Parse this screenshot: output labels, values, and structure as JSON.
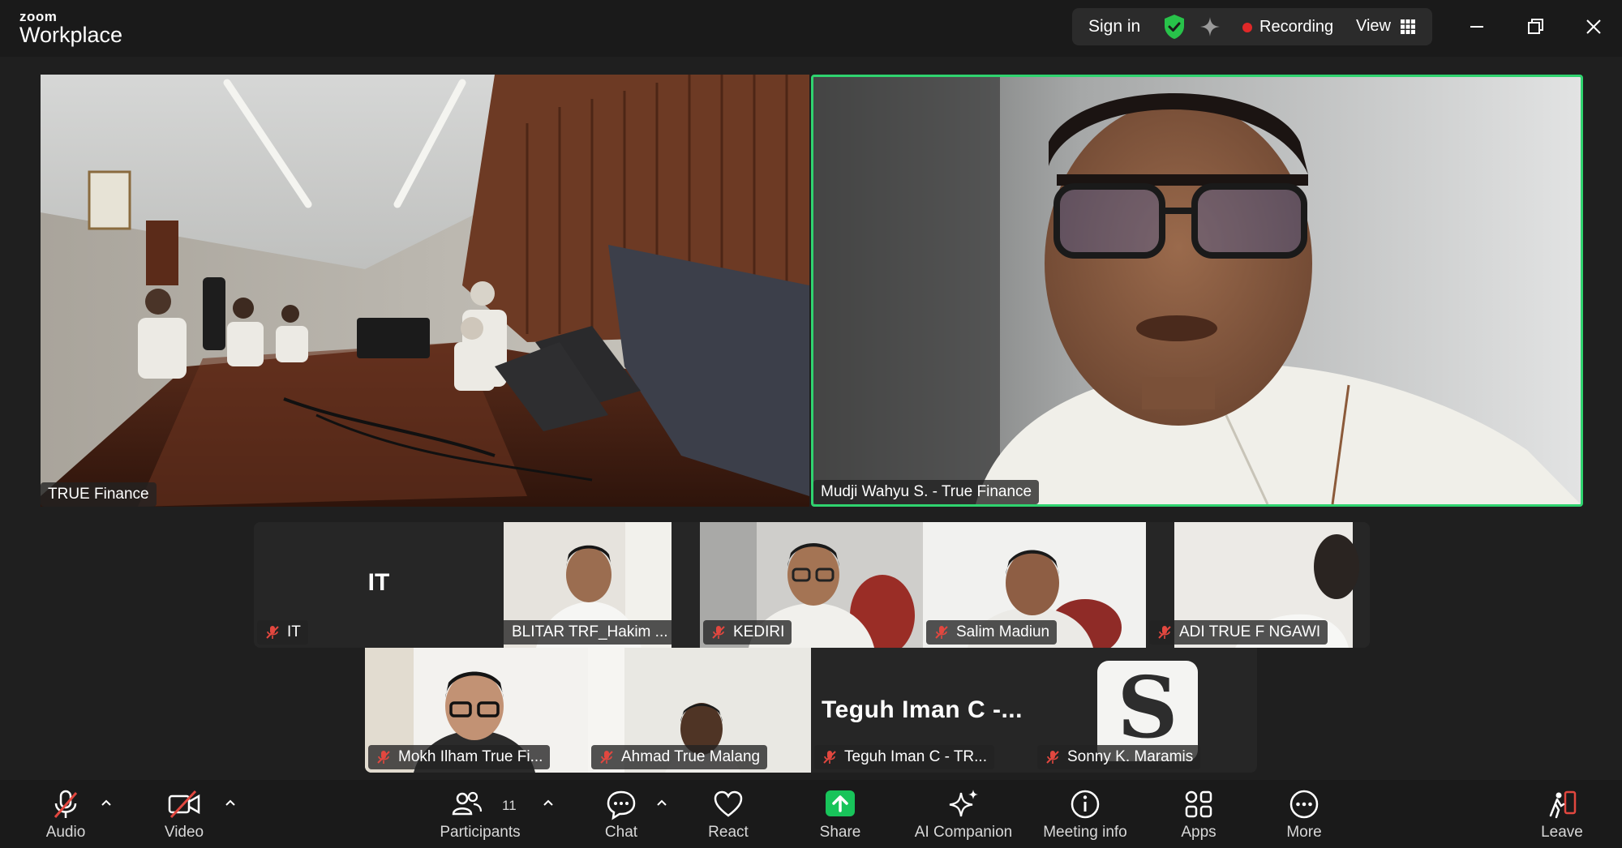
{
  "app": {
    "brand_small": "zoom",
    "brand_large": "Workplace"
  },
  "topbar": {
    "sign_in": "Sign in",
    "recording": "Recording",
    "view": "View"
  },
  "main_tiles": [
    {
      "name": "TRUE Finance"
    },
    {
      "name": "Mudji Wahyu S. - True Finance",
      "active_speaker": true
    }
  ],
  "gallery_row1": [
    {
      "name": "IT",
      "initials": "IT",
      "muted": true,
      "video": false
    },
    {
      "name": "BLITAR TRF_Hakim ...",
      "muted": true
    },
    {
      "name": "KEDIRI",
      "muted": true
    },
    {
      "name": "Salim Madiun",
      "muted": true
    },
    {
      "name": "ADI TRUE F NGAWI",
      "muted": true
    }
  ],
  "gallery_row2": [
    {
      "name": "Mokh Ilham True Fi...",
      "muted": true
    },
    {
      "name": "Ahmad True Malang",
      "muted": true
    },
    {
      "name": "Teguh Iman C - TR...",
      "display_text": "Teguh Iman C -...",
      "muted": true,
      "video": false
    },
    {
      "name": "Sonny K. Maramis",
      "avatar_letter": "S",
      "muted": true
    }
  ],
  "toolbar": {
    "audio": "Audio",
    "video": "Video",
    "participants": "Participants",
    "participants_count": "11",
    "chat": "Chat",
    "react": "React",
    "share": "Share",
    "ai_companion": "AI Companion",
    "meeting_info": "Meeting info",
    "apps": "Apps",
    "more": "More",
    "leave": "Leave"
  },
  "colors": {
    "active_speaker_border": "#2fd36f",
    "share_green": "#18c45a",
    "recording_dot": "#e02828",
    "shield_green": "#28c24a"
  }
}
